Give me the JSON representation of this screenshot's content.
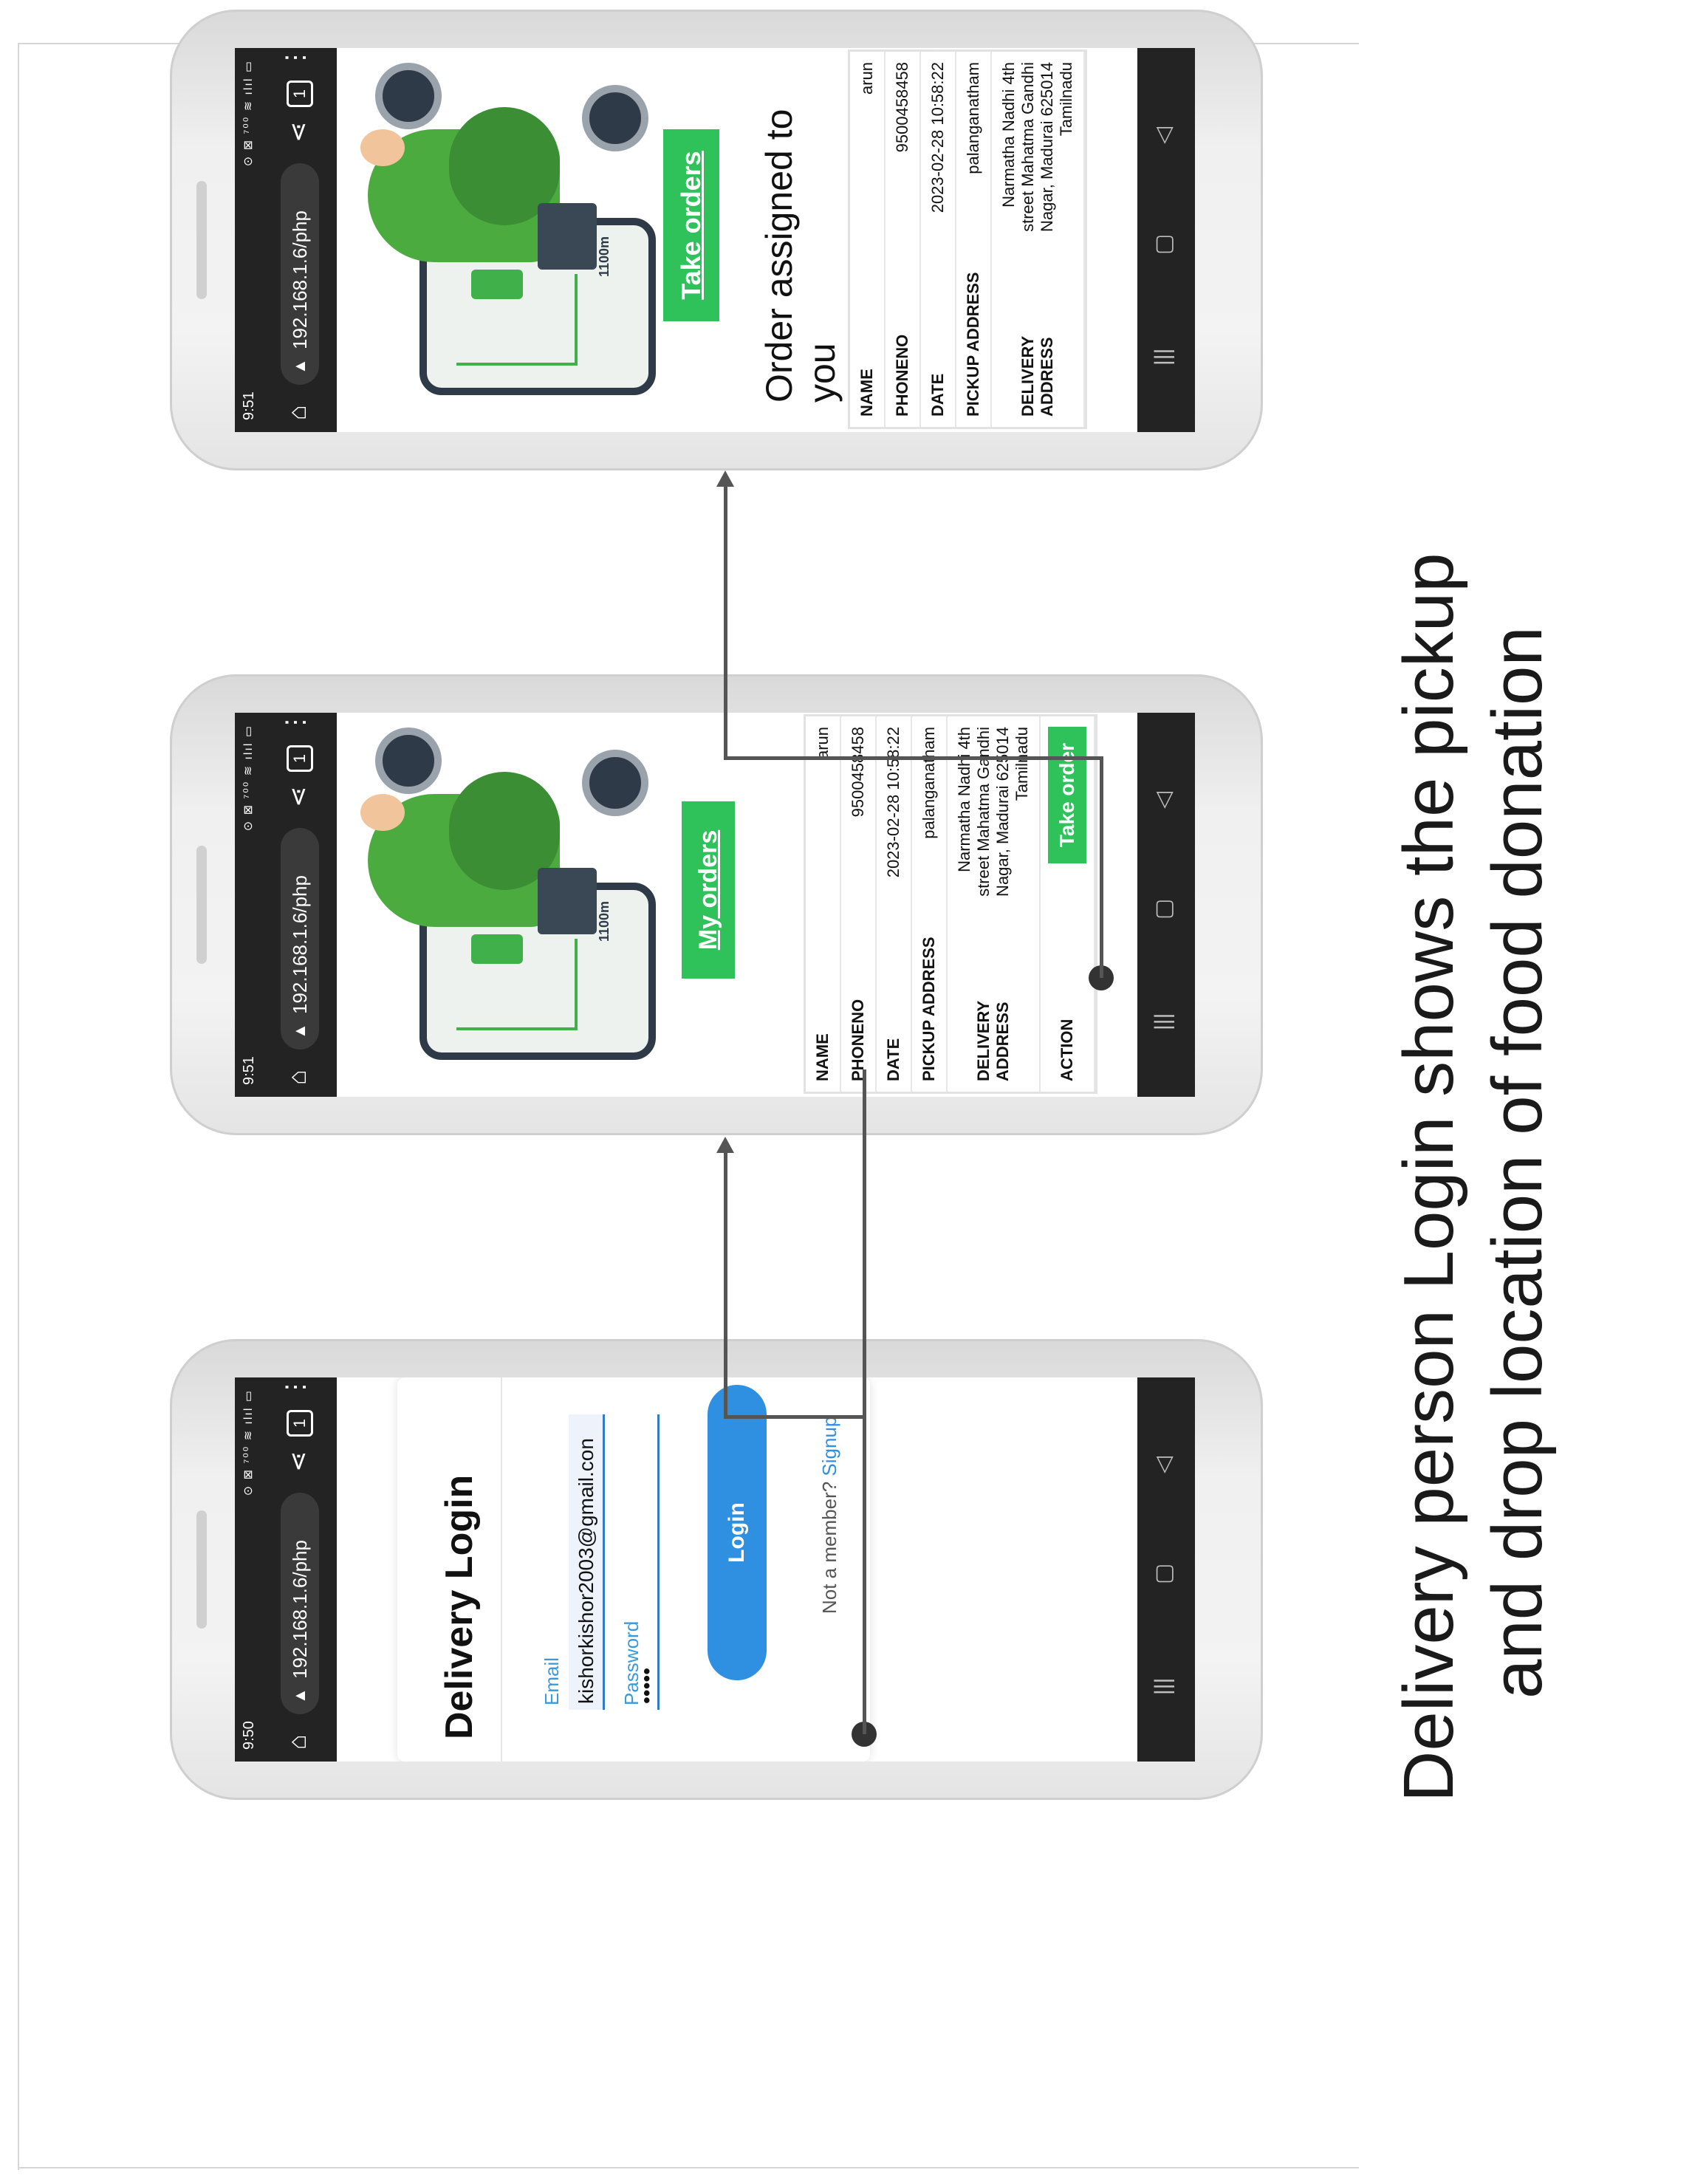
{
  "browser": {
    "url": "192.168.1.6/php",
    "status_times": [
      "9:50",
      "9:51",
      "9:51"
    ],
    "sys_icons": "⊙ ⊠  ⁷⁰⁰ ≋ ılıl ▭"
  },
  "login": {
    "title": "Delivery Login",
    "email_label": "Email",
    "email_value": "kishorkishor2003@gmail.con",
    "password_label": "Password",
    "password_value": "•••••",
    "login_button": "Login",
    "signup_prefix": "Not a member? ",
    "signup_link": "Signup"
  },
  "orders_screen": {
    "button": "My orders",
    "map_label": "1100m",
    "rows": [
      {
        "key": "NAME",
        "value": "arun"
      },
      {
        "key": "PHONENO",
        "value": "9500458458"
      },
      {
        "key": "DATE",
        "value": "2023-02-28 10:58:22"
      },
      {
        "key": "PICKUP ADDRESS",
        "value": "palanganatham"
      },
      {
        "key": "DELIVERY ADDRESS",
        "value": "Narmatha Nadhi 4th street Mahatma Gandhi Nagar, Madurai 625014 Tamilnadu"
      },
      {
        "key": "ACTION",
        "value": "Take order"
      }
    ]
  },
  "assigned_screen": {
    "button": "Take orders",
    "map_label": "1100m",
    "title": "Order assigned to you",
    "rows": [
      {
        "key": "NAME",
        "value": "arun"
      },
      {
        "key": "PHONENO",
        "value": "9500458458"
      },
      {
        "key": "DATE",
        "value": "2023-02-28 10:58:22"
      },
      {
        "key": "PICKUP ADDRESS",
        "value": "palanganatham"
      },
      {
        "key": "DELIVERY ADDRESS",
        "value": "Narmatha Nadhi 4th street Mahatma Gandhi Nagar, Madurai 625014 Tamilnadu"
      }
    ]
  },
  "caption": {
    "line1": "Delivery person Login shows the pickup",
    "line2": "and drop location of food donation"
  },
  "icons": [
    "home-icon",
    "warning-icon",
    "share-icon",
    "tabs-icon",
    "menu-icon",
    "back-icon",
    "recents-icon",
    "overview-icon"
  ]
}
